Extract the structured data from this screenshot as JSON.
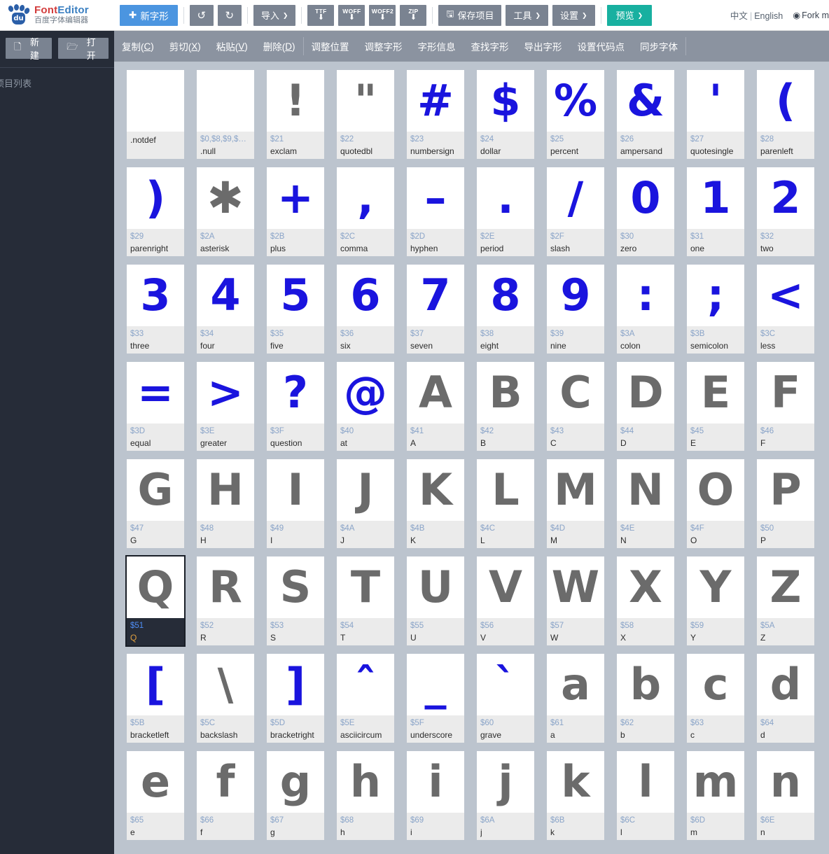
{
  "brand": {
    "title_part1": "Font",
    "title_part2": "Editor",
    "subtitle": "百度字体编辑器",
    "logo_text": "du"
  },
  "toolbar": {
    "new_glyph": "新字形",
    "undo": "↺",
    "redo": "↻",
    "import": "导入",
    "export_ttf": "TTF",
    "export_woff": "WOFF",
    "export_woff2": "WOFF2",
    "export_zip": "ZIP",
    "save_project": "保存项目",
    "tools": "工具",
    "settings": "设置",
    "preview": "预览",
    "caret": "❯"
  },
  "topright": {
    "lang_cn": "中文",
    "lang_divider": "|",
    "lang_en": "English",
    "fork": "Fork m"
  },
  "menubar": {
    "group1": [
      {
        "label": "复制(C)",
        "accel": "C"
      },
      {
        "label": "剪切(X)",
        "accel": "X"
      },
      {
        "label": "粘贴(V)",
        "accel": "V"
      },
      {
        "label": "删除(D)",
        "accel": "D"
      }
    ],
    "group2": [
      {
        "label": "调整位置"
      },
      {
        "label": "调整字形"
      },
      {
        "label": "字形信息"
      },
      {
        "label": "查找字形"
      },
      {
        "label": "导出字形"
      },
      {
        "label": "设置代码点"
      },
      {
        "label": "同步字体"
      }
    ]
  },
  "sidebar": {
    "new_project": "新建",
    "open_project": "打开",
    "project_list_label": "项目列表"
  },
  "colors": {
    "accent_blue": "#4b95e0",
    "accent_teal": "#18b0a0",
    "toolbar_gray": "#7a8391",
    "menubar_gray": "#8b93a0",
    "sidebar_dark": "#262c38",
    "content_bg": "#bcc4ce",
    "glyph_gray": "#6b6b6b",
    "glyph_blue": "#1a14de",
    "selected_name": "#e0a040"
  },
  "glyphs": [
    {
      "char": "",
      "code": "",
      "name": ".notdef",
      "color": "gray",
      "selected": false
    },
    {
      "char": "",
      "code": "$0,$8,$9,$1…",
      "name": ".null",
      "color": "gray",
      "selected": false
    },
    {
      "char": "!",
      "code": "$21",
      "name": "exclam",
      "color": "gray",
      "selected": false
    },
    {
      "char": "\"",
      "code": "$22",
      "name": "quotedbl",
      "color": "gray",
      "selected": false
    },
    {
      "char": "#",
      "code": "$23",
      "name": "numbersign",
      "color": "blue",
      "selected": false
    },
    {
      "char": "$",
      "code": "$24",
      "name": "dollar",
      "color": "blue",
      "selected": false
    },
    {
      "char": "%",
      "code": "$25",
      "name": "percent",
      "color": "blue",
      "selected": false
    },
    {
      "char": "&",
      "code": "$26",
      "name": "ampersand",
      "color": "blue",
      "selected": false
    },
    {
      "char": "'",
      "code": "$27",
      "name": "quotesingle",
      "color": "blue",
      "selected": false
    },
    {
      "char": "(",
      "code": "$28",
      "name": "parenleft",
      "color": "blue",
      "selected": false
    },
    {
      "char": ")",
      "code": "$29",
      "name": "parenright",
      "color": "blue",
      "selected": false
    },
    {
      "char": "✱",
      "code": "$2A",
      "name": "asterisk",
      "color": "gray",
      "selected": false
    },
    {
      "char": "+",
      "code": "$2B",
      "name": "plus",
      "color": "blue",
      "selected": false
    },
    {
      "char": ",",
      "code": "$2C",
      "name": "comma",
      "color": "blue",
      "selected": false
    },
    {
      "char": "–",
      "code": "$2D",
      "name": "hyphen",
      "color": "blue",
      "selected": false
    },
    {
      "char": ".",
      "code": "$2E",
      "name": "period",
      "color": "blue",
      "selected": false
    },
    {
      "char": "/",
      "code": "$2F",
      "name": "slash",
      "color": "blue",
      "selected": false
    },
    {
      "char": "0",
      "code": "$30",
      "name": "zero",
      "color": "blue",
      "selected": false
    },
    {
      "char": "1",
      "code": "$31",
      "name": "one",
      "color": "blue",
      "selected": false
    },
    {
      "char": "2",
      "code": "$32",
      "name": "two",
      "color": "blue",
      "selected": false
    },
    {
      "char": "3",
      "code": "$33",
      "name": "three",
      "color": "blue",
      "selected": false
    },
    {
      "char": "4",
      "code": "$34",
      "name": "four",
      "color": "blue",
      "selected": false
    },
    {
      "char": "5",
      "code": "$35",
      "name": "five",
      "color": "blue",
      "selected": false
    },
    {
      "char": "6",
      "code": "$36",
      "name": "six",
      "color": "blue",
      "selected": false
    },
    {
      "char": "7",
      "code": "$37",
      "name": "seven",
      "color": "blue",
      "selected": false
    },
    {
      "char": "8",
      "code": "$38",
      "name": "eight",
      "color": "blue",
      "selected": false
    },
    {
      "char": "9",
      "code": "$39",
      "name": "nine",
      "color": "blue",
      "selected": false
    },
    {
      "char": ":",
      "code": "$3A",
      "name": "colon",
      "color": "blue",
      "selected": false
    },
    {
      "char": ";",
      "code": "$3B",
      "name": "semicolon",
      "color": "blue",
      "selected": false
    },
    {
      "char": "<",
      "code": "$3C",
      "name": "less",
      "color": "blue",
      "selected": false
    },
    {
      "char": "=",
      "code": "$3D",
      "name": "equal",
      "color": "blue",
      "selected": false
    },
    {
      "char": ">",
      "code": "$3E",
      "name": "greater",
      "color": "blue",
      "selected": false
    },
    {
      "char": "?",
      "code": "$3F",
      "name": "question",
      "color": "blue",
      "selected": false
    },
    {
      "char": "@",
      "code": "$40",
      "name": "at",
      "color": "blue",
      "selected": false
    },
    {
      "char": "A",
      "code": "$41",
      "name": "A",
      "color": "gray",
      "selected": false
    },
    {
      "char": "B",
      "code": "$42",
      "name": "B",
      "color": "gray",
      "selected": false
    },
    {
      "char": "C",
      "code": "$43",
      "name": "C",
      "color": "gray",
      "selected": false
    },
    {
      "char": "D",
      "code": "$44",
      "name": "D",
      "color": "gray",
      "selected": false
    },
    {
      "char": "E",
      "code": "$45",
      "name": "E",
      "color": "gray",
      "selected": false
    },
    {
      "char": "F",
      "code": "$46",
      "name": "F",
      "color": "gray",
      "selected": false
    },
    {
      "char": "G",
      "code": "$47",
      "name": "G",
      "color": "gray",
      "selected": false
    },
    {
      "char": "H",
      "code": "$48",
      "name": "H",
      "color": "gray",
      "selected": false
    },
    {
      "char": "I",
      "code": "$49",
      "name": "I",
      "color": "gray",
      "selected": false
    },
    {
      "char": "J",
      "code": "$4A",
      "name": "J",
      "color": "gray",
      "selected": false
    },
    {
      "char": "K",
      "code": "$4B",
      "name": "K",
      "color": "gray",
      "selected": false
    },
    {
      "char": "L",
      "code": "$4C",
      "name": "L",
      "color": "gray",
      "selected": false
    },
    {
      "char": "M",
      "code": "$4D",
      "name": "M",
      "color": "gray",
      "selected": false
    },
    {
      "char": "N",
      "code": "$4E",
      "name": "N",
      "color": "gray",
      "selected": false
    },
    {
      "char": "O",
      "code": "$4F",
      "name": "O",
      "color": "gray",
      "selected": false
    },
    {
      "char": "P",
      "code": "$50",
      "name": "P",
      "color": "gray",
      "selected": false
    },
    {
      "char": "Q",
      "code": "$51",
      "name": "Q",
      "color": "gray",
      "selected": true
    },
    {
      "char": "R",
      "code": "$52",
      "name": "R",
      "color": "gray",
      "selected": false
    },
    {
      "char": "S",
      "code": "$53",
      "name": "S",
      "color": "gray",
      "selected": false
    },
    {
      "char": "T",
      "code": "$54",
      "name": "T",
      "color": "gray",
      "selected": false
    },
    {
      "char": "U",
      "code": "$55",
      "name": "U",
      "color": "gray",
      "selected": false
    },
    {
      "char": "V",
      "code": "$56",
      "name": "V",
      "color": "gray",
      "selected": false
    },
    {
      "char": "W",
      "code": "$57",
      "name": "W",
      "color": "gray",
      "selected": false
    },
    {
      "char": "X",
      "code": "$58",
      "name": "X",
      "color": "gray",
      "selected": false
    },
    {
      "char": "Y",
      "code": "$59",
      "name": "Y",
      "color": "gray",
      "selected": false
    },
    {
      "char": "Z",
      "code": "$5A",
      "name": "Z",
      "color": "gray",
      "selected": false
    },
    {
      "char": "[",
      "code": "$5B",
      "name": "bracketleft",
      "color": "blue",
      "selected": false
    },
    {
      "char": "\\",
      "code": "$5C",
      "name": "backslash",
      "color": "gray",
      "selected": false
    },
    {
      "char": "]",
      "code": "$5D",
      "name": "bracketright",
      "color": "blue",
      "selected": false
    },
    {
      "char": "ˆ",
      "code": "$5E",
      "name": "asciicircum",
      "color": "blue",
      "selected": false
    },
    {
      "char": "_",
      "code": "$5F",
      "name": "underscore",
      "color": "blue",
      "selected": false
    },
    {
      "char": "`",
      "code": "$60",
      "name": "grave",
      "color": "blue",
      "selected": false
    },
    {
      "char": "a",
      "code": "$61",
      "name": "a",
      "color": "gray",
      "selected": false
    },
    {
      "char": "b",
      "code": "$62",
      "name": "b",
      "color": "gray",
      "selected": false
    },
    {
      "char": "c",
      "code": "$63",
      "name": "c",
      "color": "gray",
      "selected": false
    },
    {
      "char": "d",
      "code": "$64",
      "name": "d",
      "color": "gray",
      "selected": false
    },
    {
      "char": "e",
      "code": "$65",
      "name": "e",
      "color": "gray",
      "selected": false
    },
    {
      "char": "f",
      "code": "$66",
      "name": "f",
      "color": "gray",
      "selected": false
    },
    {
      "char": "g",
      "code": "$67",
      "name": "g",
      "color": "gray",
      "selected": false
    },
    {
      "char": "h",
      "code": "$68",
      "name": "h",
      "color": "gray",
      "selected": false
    },
    {
      "char": "i",
      "code": "$69",
      "name": "i",
      "color": "gray",
      "selected": false
    },
    {
      "char": "j",
      "code": "$6A",
      "name": "j",
      "color": "gray",
      "selected": false
    },
    {
      "char": "k",
      "code": "$6B",
      "name": "k",
      "color": "gray",
      "selected": false
    },
    {
      "char": "l",
      "code": "$6C",
      "name": "l",
      "color": "gray",
      "selected": false
    },
    {
      "char": "m",
      "code": "$6D",
      "name": "m",
      "color": "gray",
      "selected": false
    },
    {
      "char": "n",
      "code": "$6E",
      "name": "n",
      "color": "gray",
      "selected": false
    }
  ]
}
